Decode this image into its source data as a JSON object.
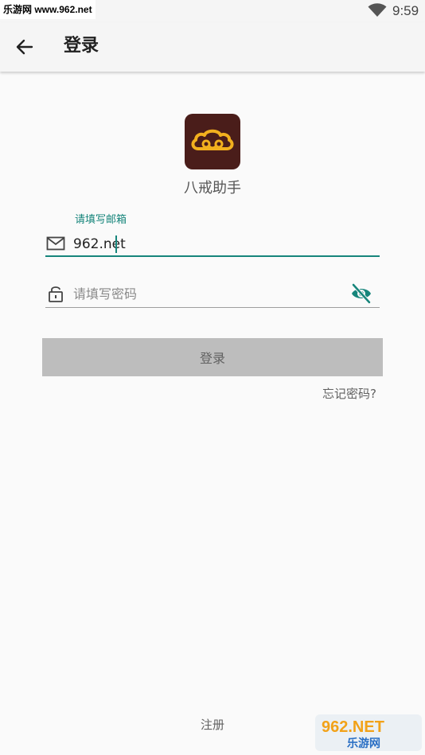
{
  "status_bar": {
    "watermark": "乐游网 www.962.net",
    "time": "9:59"
  },
  "app_bar": {
    "title": "登录"
  },
  "app": {
    "name": "八戒助手"
  },
  "email": {
    "label": "请填写邮箱",
    "value": "962.net"
  },
  "password": {
    "placeholder": "请填写密码"
  },
  "actions": {
    "login_label": "登录",
    "forgot_label": "忘记密码?",
    "register_label": "注册"
  },
  "badge": {
    "text_top": "962.NET",
    "text_bottom": "乐游网"
  },
  "colors": {
    "accent": "#16857b",
    "logo_bg": "#4a1d1a",
    "logo_gold": "#f2b01e",
    "button_disabled": "#bdbdbd"
  },
  "icons": {
    "back": "arrow-left-icon",
    "email": "mail-icon",
    "password": "lock-icon",
    "visibility": "eye-off-icon",
    "wifi": "wifi-icon"
  }
}
